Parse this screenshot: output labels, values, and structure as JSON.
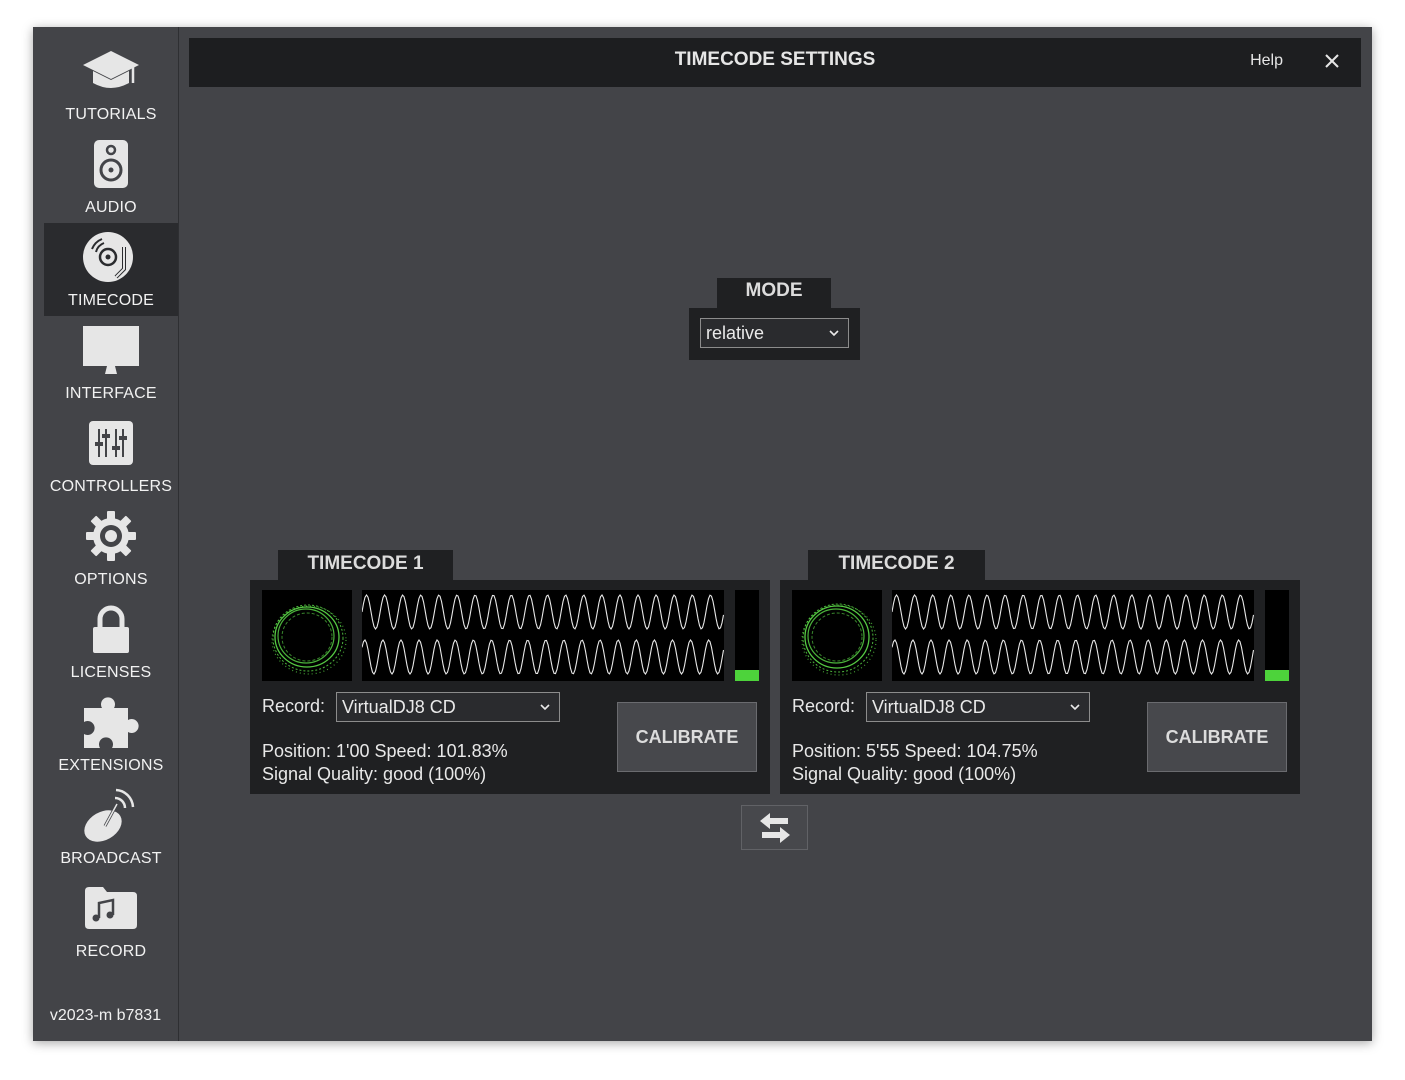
{
  "window": {
    "title": "TIMECODE SETTINGS",
    "help_label": "Help"
  },
  "sidebar": {
    "items": [
      {
        "label": "TUTORIALS",
        "icon": "graduation-cap-icon"
      },
      {
        "label": "AUDIO",
        "icon": "speaker-icon"
      },
      {
        "label": "TIMECODE",
        "icon": "vinyl-record-icon",
        "active": true
      },
      {
        "label": "INTERFACE",
        "icon": "monitor-icon"
      },
      {
        "label": "CONTROLLERS",
        "icon": "mixer-sliders-icon"
      },
      {
        "label": "OPTIONS",
        "icon": "gear-icon"
      },
      {
        "label": "LICENSES",
        "icon": "lock-icon"
      },
      {
        "label": "EXTENSIONS",
        "icon": "puzzle-piece-icon"
      },
      {
        "label": "BROADCAST",
        "icon": "satellite-dish-icon"
      },
      {
        "label": "RECORD",
        "icon": "music-folder-icon"
      }
    ],
    "version": "v2023-m b7831"
  },
  "mode": {
    "label": "MODE",
    "value": "relative"
  },
  "timecodes": [
    {
      "title": "TIMECODE 1",
      "record_label": "Record:",
      "record_value": "VirtualDJ8 CD",
      "position_speed": "Position: 1'00  Speed: 101.83%",
      "signal_quality": "Signal Quality: good (100%)",
      "calibrate_label": "CALIBRATE",
      "level": 0.12
    },
    {
      "title": "TIMECODE 2",
      "record_label": "Record:",
      "record_value": "VirtualDJ8 CD",
      "position_speed": "Position: 5'55  Speed: 104.75%",
      "signal_quality": "Signal Quality: good (100%)",
      "calibrate_label": "CALIBRATE",
      "level": 0.12
    }
  ],
  "colors": {
    "signal": "#5ee04a",
    "level": "#4dd33b",
    "panel": "#1f2022",
    "window": "#434448"
  }
}
